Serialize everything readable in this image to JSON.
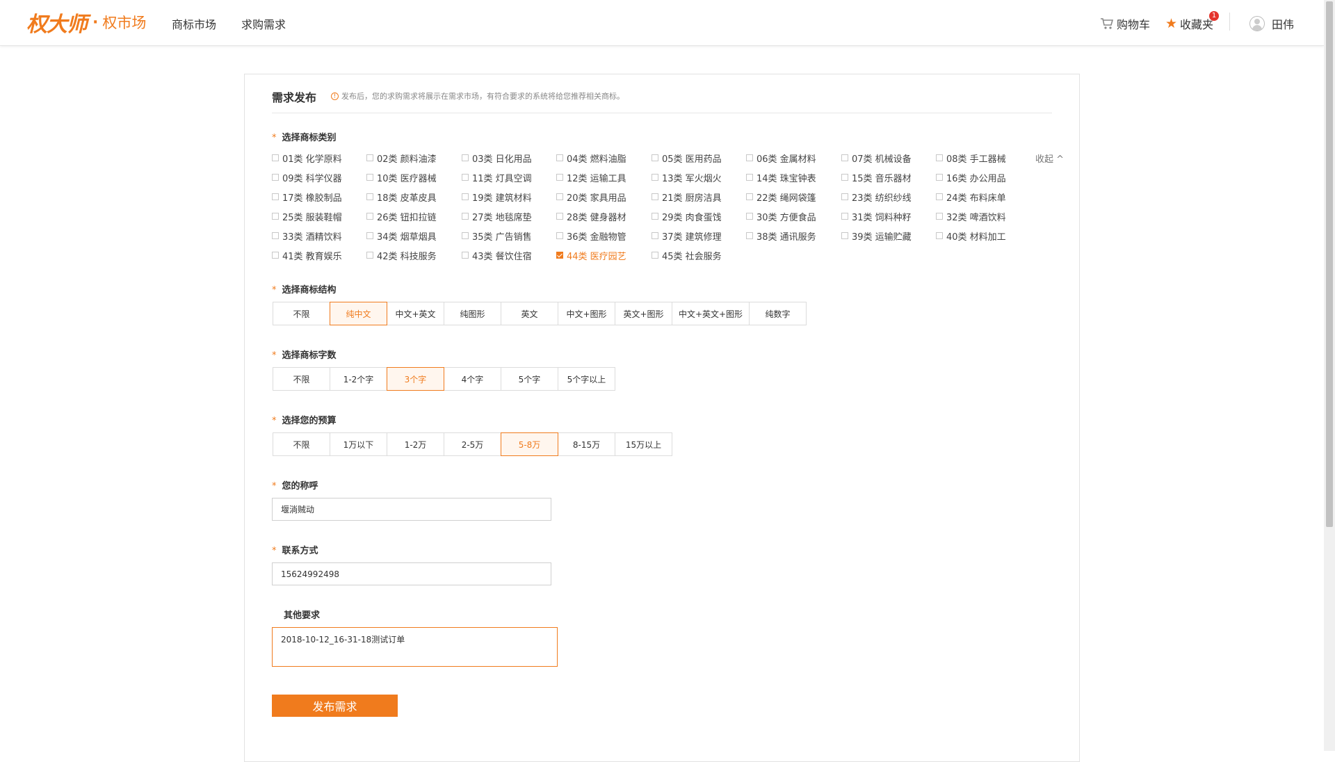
{
  "header": {
    "logo_mark": "权大师",
    "logo_dot": "·",
    "logo_sub": "权市场",
    "nav": [
      "商标市场",
      "求购需求"
    ],
    "cart_label": "购物车",
    "fav_label": "收藏夹",
    "fav_badge": "1",
    "user_name": "田伟"
  },
  "colors": {
    "accent": "#f07b1d",
    "badge": "#e5342c"
  },
  "form": {
    "title": "需求发布",
    "tip": "发布后，您的求购需求将展示在需求市场，有符合要求的系统将给您推荐相关商标。",
    "classes_label": "选择商标类别",
    "collapse_label": "收起 ^",
    "classes": [
      "01类 化学原料",
      "02类 颜料油漆",
      "03类 日化用品",
      "04类 燃料油脂",
      "05类 医用药品",
      "06类 金属材料",
      "07类 机械设备",
      "08类 手工器械",
      "09类 科学仪器",
      "10类 医疗器械",
      "11类 灯具空调",
      "12类 运输工具",
      "13类 军火烟火",
      "14类 珠宝钟表",
      "15类 音乐器材",
      "16类 办公用品",
      "17类 橡胶制品",
      "18类 皮革皮具",
      "19类 建筑材料",
      "20类 家具用品",
      "21类 厨房洁具",
      "22类 绳网袋篷",
      "23类 纺织纱线",
      "24类 布料床单",
      "25类 服装鞋帽",
      "26类 钮扣拉链",
      "27类 地毯席垫",
      "28类 健身器材",
      "29类 肉食蛋饯",
      "30类 方便食品",
      "31类 饲料种籽",
      "32类 啤酒饮料",
      "33类 酒精饮料",
      "34类 烟草烟具",
      "35类 广告销售",
      "36类 金融物管",
      "37类 建筑修理",
      "38类 通讯服务",
      "39类 运输贮藏",
      "40类 材料加工",
      "41类 教育娱乐",
      "42类 科技服务",
      "43类 餐饮住宿",
      "44类 医疗园艺",
      "45类 社会服务"
    ],
    "checked_class_index": 43,
    "structure_label": "选择商标结构",
    "structure_options": [
      "不限",
      "纯中文",
      "中文+英文",
      "纯图形",
      "英文",
      "中文+图形",
      "英文+图形",
      "中文+英文+图形",
      "纯数字"
    ],
    "structure_selected": 1,
    "chars_label": "选择商标字数",
    "chars_options": [
      "不限",
      "1-2个字",
      "3个字",
      "4个字",
      "5个字",
      "5个字以上"
    ],
    "chars_selected": 2,
    "budget_label": "选择您的预算",
    "budget_options": [
      "不限",
      "1万以下",
      "1-2万",
      "2-5万",
      "5-8万",
      "8-15万",
      "15万以上"
    ],
    "budget_selected": 4,
    "name_label": "您的称呼",
    "name_value": "堰淌贼动",
    "contact_label": "联系方式",
    "contact_value": "15624992498",
    "other_label": "其他要求",
    "other_value": "2018-10-12_16-31-18测试订单",
    "submit_label": "发布需求"
  }
}
